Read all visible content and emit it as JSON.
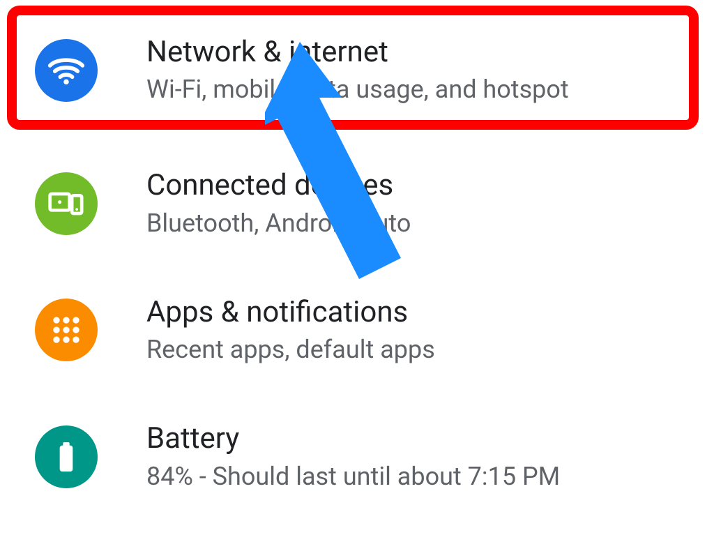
{
  "settings": {
    "items": [
      {
        "title": "Network & internet",
        "subtitle": "Wi-Fi, mobile, data usage, and hotspot",
        "icon": "wifi-icon",
        "color": "#1a73e8"
      },
      {
        "title": "Connected devices",
        "subtitle": "Bluetooth, Android Auto",
        "icon": "devices-icon",
        "color": "#72bb29"
      },
      {
        "title": "Apps & notifications",
        "subtitle": "Recent apps, default apps",
        "icon": "apps-icon",
        "color": "#fb8c00"
      },
      {
        "title": "Battery",
        "subtitle": "84% - Should last until about 7:15 PM",
        "icon": "battery-icon",
        "color": "#009688"
      }
    ]
  },
  "annotation": {
    "highlight_color": "#ff0000",
    "arrow_color": "#1a8cff"
  }
}
